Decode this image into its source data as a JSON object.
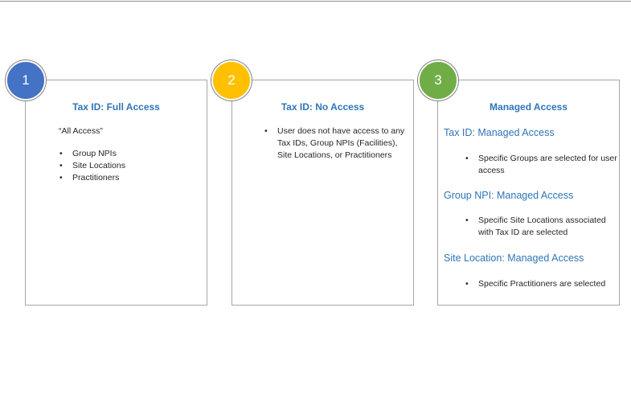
{
  "theme": {
    "title_color": "#2e75b6",
    "badge_colors": [
      "#4472c4",
      "#ffc000",
      "#70ad47"
    ]
  },
  "cards": [
    {
      "number": "1",
      "title": "Tax ID: Full Access",
      "intro": "“All Access”",
      "bullets": [
        "Group NPIs",
        "Site Locations",
        "Practitioners"
      ]
    },
    {
      "number": "2",
      "title": "Tax ID: No Access",
      "bullets": [
        "User does not have access to any Tax IDs, Group NPIs (Facilities), Site Locations, or Practitioners"
      ]
    },
    {
      "number": "3",
      "title": "Managed Access",
      "sections": [
        {
          "heading": "Tax ID: Managed Access",
          "bullet": "Specific Groups are selected for user access"
        },
        {
          "heading": "Group NPI: Managed Access",
          "bullet": "Specific Site Locations associated with Tax ID are selected"
        },
        {
          "heading": "Site Location: Managed Access",
          "bullet": "Specific Practitioners are selected"
        }
      ]
    }
  ]
}
